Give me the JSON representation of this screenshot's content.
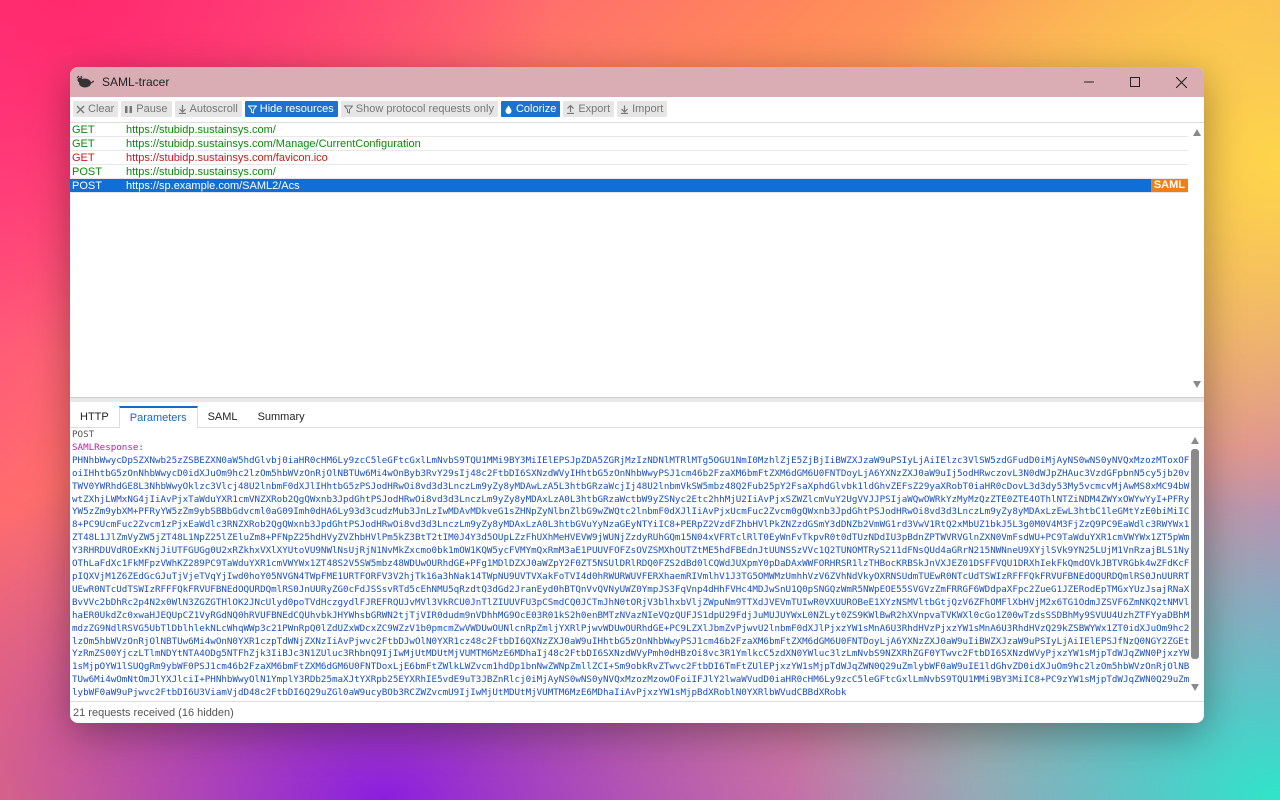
{
  "window": {
    "title": "SAML-tracer"
  },
  "toolbar": {
    "clear": "Clear",
    "pause": "Pause",
    "autoscroll": "Autoscroll",
    "hide_resources": "Hide resources",
    "show_protocol": "Show protocol requests only",
    "colorize": "Colorize",
    "export": "Export",
    "import": "Import"
  },
  "requests": [
    {
      "method": "GET",
      "url": "https://stubidp.sustainsys.com/",
      "status": "ok"
    },
    {
      "method": "GET",
      "url": "https://stubidp.sustainsys.com/Manage/CurrentConfiguration",
      "status": "ok"
    },
    {
      "method": "GET",
      "url": "https://stubidp.sustainsys.com/favicon.ico",
      "status": "err"
    },
    {
      "method": "POST",
      "url": "https://stubidp.sustainsys.com/",
      "status": "ok"
    },
    {
      "method": "POST",
      "url": "https://sp.example.com/SAML2/Acs",
      "status": "sel",
      "badge": "SAML"
    }
  ],
  "tabs": {
    "http": "HTTP",
    "parameters": "Parameters",
    "saml": "SAML",
    "summary": "Summary"
  },
  "detail": {
    "method": "POST",
    "param_name": "SAMLResponse:",
    "value": "PHNhbWwycDpSZXNwb25zZSBEZXN0aW5hdGlvbj0iaHR0cHM6Ly9zcC5leGFtcGxlLmNvbS9TQU1MMi9BY3MiIElEPSJpZDA5ZGRjMzIzNDNlMTRlMTg5OGU1NmI0MzhlZjE5ZjBjIiBWZXJzaW9uPSIyLjAiIElzc3VlSW5zdGFudD0iMjAyNS0wNS0yNVQxMzozMToxOFoiIHhtbG5zOnNhbWwycD0idXJuOm9hc2lzOm5hbWVzOnRjOlNBTUw6Mi4wOnByb3RvY29sIj48c2FtbDI6SXNzdWVyIHhtbG5zOnNhbWwyPSJ1cm46b2FzaXM6bmFtZXM6dGM6U0FNTDoyLjA6YXNzZXJ0aW9uIj5odHRwczovL3N0dWJpZHAuc3VzdGFpbnN5cy5jb20vTWV0YWRhdGE8L3NhbWwyOklzc3Vlcj48U2lnbmF0dXJlIHhtbG5zPSJodHRwOi8vd3d3LnczLm9yZy8yMDAwLzA5L3htbGRzaWcjIj48U2lnbmVkSW5mbz48Q2Fub25pY2FsaXphdGlvbk1ldGhvZEFsZ29yaXRobT0iaHR0cDovL3d3dy53My5vcmcvMjAwMS8xMC94bWwtZXhjLWMxNG4jIiAvPjxTaWduYXR1cmVNZXRob2QgQWxnb3JpdGhtPSJodHRwOi8vd3d3LnczLm9yZy8yMDAxLzA0L3htbGRzaWctbW9yZSNyc2Etc2hhMjU2IiAvPjxSZWZlcmVuY2UgVVJJPSIjaWQwOWRkYzMyMzQzZTE0ZTE4OThlNTZiNDM4ZWYxOWYwYyI+PFRyYW5zZm9ybXM+PFRyYW5zZm9ybSBBbGdvcml0aG09Imh0dHA6Ly93d3cudzMub3JnLzIwMDAvMDkveG1sZHNpZyNlbnZlbG9wZWQtc2lnbmF0dXJlIiAvPjxUcmFuc2Zvcm0gQWxnb3JpdGhtPSJodHRwOi8vd3d3LnczLm9yZy8yMDAxLzEwL3htbC1leGMtYzE0biMiIC8+PC9UcmFuc2Zvcm1zPjxEaWdlc3RNZXRob2QgQWxnb3JpdGhtPSJodHRwOi8vd3d3LnczLm9yZy8yMDAxLzA0L3htbGVuYyNzaGEyNTYiIC8+PERpZ2VzdFZhbHVlPkZNZzdGSmY3dDNZb2VmWG1rd3VwV1RtQ2xMbUZ1bkJ5L3g0M0V4M3FjZzQ9PC9EaWdlc3RWYWx1ZT48L1JlZmVyZW5jZT48L1NpZ25lZEluZm8+PFNpZ25hdHVyZVZhbHVlPm5kZ3BtT2tIM0J4Y3d5OUpLZzFhUXhMeHVEVW9jWUNjZzdyRUhGQm15N04xVFRTclRlT0EyWnFvTkpvR0t0dTUzNDdIU3pBdnZPTWVRVGlnZXN0VmFsdWU+PC9TaWduYXR1cmVWYWx1ZT5pWmY3RHRDUVdROExKNjJiUTFGUGg0U2xRZkhxVXlXYUtoVU9NWlNsUjRjN1NvMkZxcmo0bk1mOW1KQW5ycFVMYmQxRmM3aE1PUUVFOFZsOVZSMXhOUTZtME5hdFBEdnJtUUNSSzVVc1Q2TUNOMTRyS211dFNsQUd4aGRrN215NWNneU9XYjlSVk9YN25LUjM1VnRzajBLS1NyOThLaFdXc1FkMFpzVWhKZ289PC9TaWduYXR1cmVWYWx1ZT48S2V5SW5mbz48WDUwOURhdGE+PFg1MDlDZXJ0aWZpY2F0ZT5NSUlDRlRDQ0FZS2dBd0lCQWdJUXpmY0pDaDAxWWFORHRSR1lzTHBocKRBSkJnVXJEZ01DSFFVQU1DRXhIekFkQmdOVkJBTVRGbk4wZFdKcFpIQXVjM1Z6ZEdGcGJuTjVjeTVqYjIwd0hoY05NVGN4TWpFME1URTFORFV3V2hjTk16a3hNak14TWpNU9UVTVXakFoTVI4d0hRWURWUVFERXhaemRIVmlhV1J3TG5OMWMzUmhhVzV6ZVhNdVkyOXRNSUdmTUEwR0NTcUdTSWIzRFFFQkFRVUFBNEdOQURDQmlRS0JnUURRTUEwR0NTcUdTSWIzRFFFQkFRVUFBNEdOQURDQmlRS0JnUURyZG0cFdJSSsvRTd5cEhNMU5qRzdtQ3dGd2JranEyd0hBTQnVvQVNyUWZ0YmpJS3FqVnp4dHhFVHc4MDJwSnU1Q0pSNGQzWmR5NWpEOE55SVGVzZmFRRGF6WDdpaXFpc2ZueG1JZERodEpTMGxYUzJsajRNaXBvVVc2bDhRc2p4N2x0WlN3ZGZGTHlOK2JNcUlyd0poTVdHczgydlFJREFRQUJvMVl3VkRCU0JnTlZIUUVFU3pCSmdCQ0JCTmJhN0tORjV3blhxbVljZWpuNm9TTXdJVEVmTUIwR0VXUUROBeE1XYzNSMVltbGtjQzV6ZFhOMFlXbHVjM2x6TG1OdmJZSVF6ZmNKQ2tNMVlhaER0UkdZc0xwaHJEQUpCZ1VyRGdNQ0hRVUFBNEdCQUhvbkJHYWhsbGRWN2tjTjVIR0dudm9nVDhhMG9OcE03R01kS2h0enBMTzNVazNIeVQzQUFJS1dpU29FdjJuMUJUYWxL0NZLyt0ZS9KWlBwR2hXVnpvaTVKWXl0cGo1Z00wTzdsSSDBhMy9SVUU4UzhZTFYyaDBhMmdzZG9NdlRSVG5UbTlDblhlekNLcWhqWWp3c21PWnRpQ0lZdUZxWDcxZC9WZzV1b0pmcmZwVWDUwOUNlcnRpZmljYXRlPjwvWDUwOURhdGE+PC9LZXlJbmZvPjwvU2lnbmF0dXJlPjxzYW1sMnA6U3RhdHVzPjxzYW1sMnA6U3RhdHVzQ29kZSBWYWx1ZT0idXJuOm9hc2lzOm5hbWVzOnRjOlNBTUw6Mi4wOnN0YXR1czpTdWNjZXNzIiAvPjwvc2FtbDJwOlN0YXR1cz48c2FtbDI6QXNzZXJ0aW9uIHhtbG5zOnNhbWwyPSJ1cm46b2FzaXM6bmFtZXM6dGM6U0FNTDoyLjA6YXNzZXJ0aW9uIiBWZXJzaW9uPSIyLjAiIElEPSJfNzQ0NGY2ZGEtYzRmZS00YjczLTlmNDYtNTA4ODg5NTFhZjk3IiBJc3N1ZUluc3RhbnQ9IjIwMjUtMDUtMjVUMTM6MzE6MDhaIj48c2FtbDI6SXNzdWVyPmh0dHBzOi8vc3R1YmlkcC5zdXN0YWluc3lzLmNvbS9NZXRhZGF0YTwvc2FtbDI6SXNzdWVyPjxzYW1sMjpTdWJqZWN0PjxzYW1sMjpOYW1lSUQgRm9ybWF0PSJ1cm46b2FzaXM6bmFtZXM6dGM6U0FNTDoxLjE6bmFtZWlkLWZvcm1hdDp1bnNwZWNpZmllZCI+Sm9obkRvZTwvc2FtbDI6TmFtZUlEPjxzYW1sMjpTdWJqZWN0Q29uZmlybWF0aW9uIE1ldGhvZD0idXJuOm9hc2lzOm5hbWVzOnRjOlNBTUw6Mi4wOmNtOmJlYXJlciI+PHNhbWwyOlN1YmplY3RDb25maXJtYXRpb25EYXRhIE5vdE9uT3JBZnRlcj0iMjAyNS0wNS0yNVQxMzozMzowOFoiIFJlY2lwaWVudD0iaHR0cHM6Ly9zcC5leGFtcGxlLmNvbS9TQU1MMi9BY3MiIC8+PC9zYW1sMjpTdWJqZWN0Q29uZmlybWF0aW9uPjwvc2FtbDI6U3ViamVjdD48c2FtbDI6Q29uZGl0aW9ucyBOb3RCZWZvcmU9IjIwMjUtMDUtMjVUMTM6MzE6MDhaIiAvPjxzYW1sMjpBdXRoblN0YXRlbWVudCBBdXRobk"
  },
  "status": {
    "text": "21 requests received (16 hidden)"
  },
  "colors": {
    "titlebar": "#d9adb3",
    "selected": "#0f6fd6",
    "ok": "#0a8a0a",
    "error": "#d01818",
    "saml_badge": "#ef7f1a"
  }
}
